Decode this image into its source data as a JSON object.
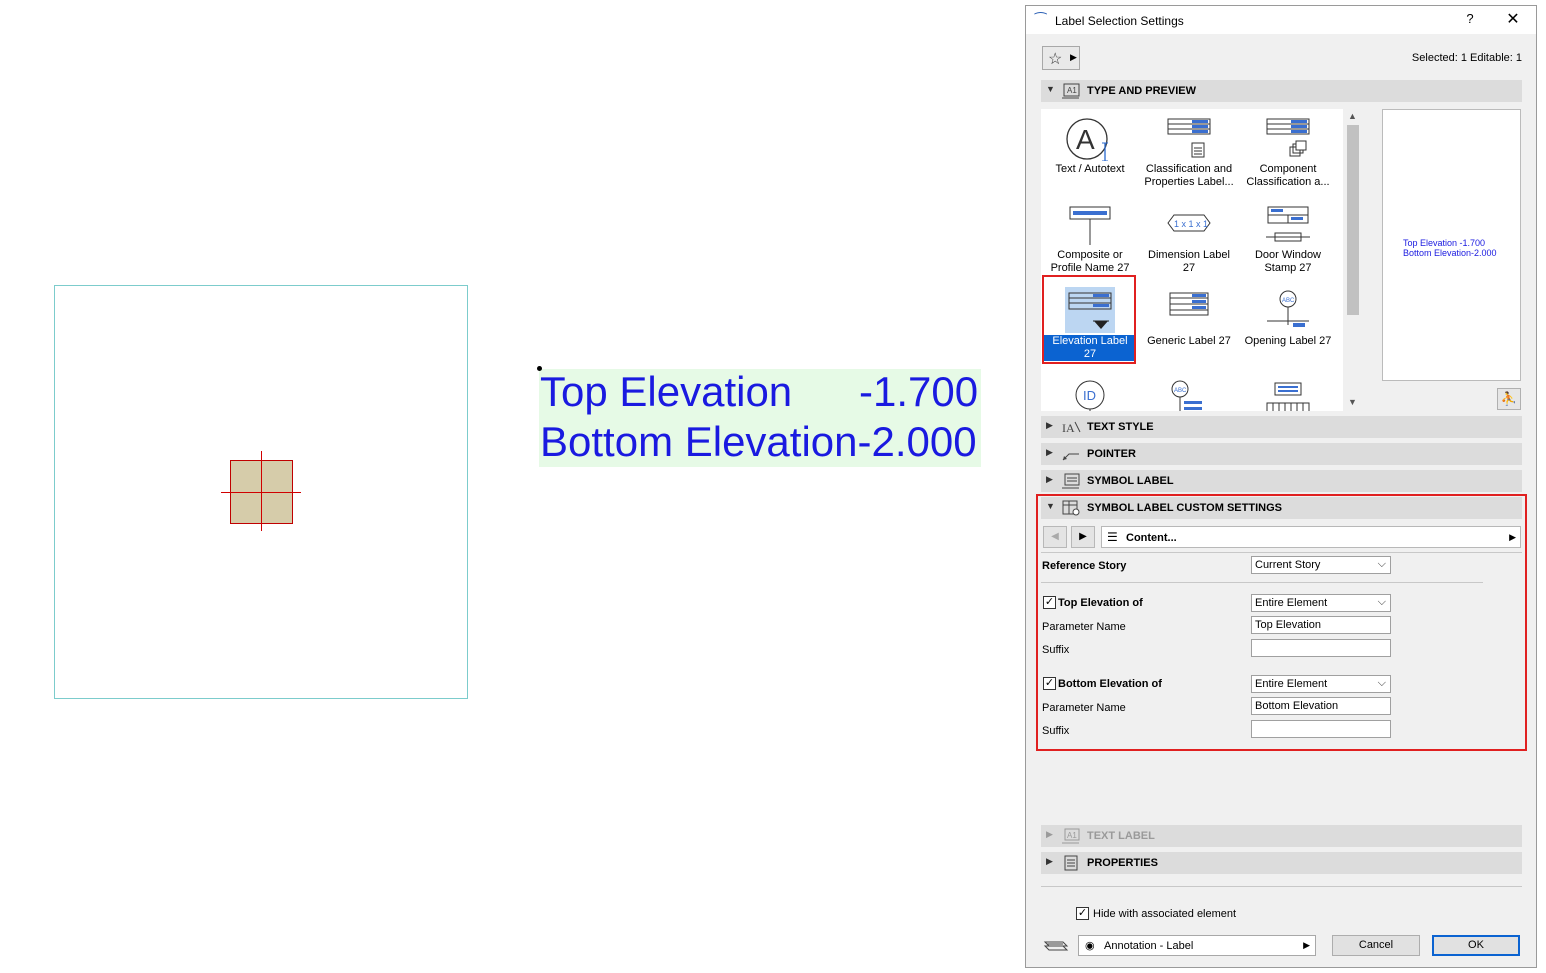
{
  "canvas": {
    "label_line1": "Top Elevation",
    "label_value1": "-1.700",
    "label_line2": "Bottom Elevation-2.000"
  },
  "dialog": {
    "title": "Label Selection Settings",
    "help": "?",
    "close": "✕",
    "selected_info": "Selected: 1 Editable: 1",
    "sections": {
      "type_preview": "TYPE AND PREVIEW",
      "text_style": "TEXT STYLE",
      "pointer": "POINTER",
      "symbol_label": "SYMBOL LABEL",
      "custom": "SYMBOL LABEL CUSTOM SETTINGS",
      "text_label": "TEXT LABEL",
      "properties": "PROPERTIES"
    },
    "types": [
      {
        "label1": "Text / Autotext",
        "label2": ""
      },
      {
        "label1": "Classification and",
        "label2": "Properties Label..."
      },
      {
        "label1": "Component",
        "label2": "Classification a..."
      },
      {
        "label1": "Composite or",
        "label2": "Profile Name 27"
      },
      {
        "label1": "Dimension Label",
        "label2": "27"
      },
      {
        "label1": "Door Window",
        "label2": "Stamp 27"
      },
      {
        "label1": "Elevation Label",
        "label2": "27"
      },
      {
        "label1": "Generic Label 27",
        "label2": ""
      },
      {
        "label1": "Opening Label 27",
        "label2": ""
      }
    ],
    "preview": {
      "line1": "Top Elevation     -1.700",
      "line2": "Bottom Elevation-2.000"
    },
    "custom": {
      "content": "Content...",
      "reference_story_label": "Reference Story",
      "reference_story_value": "Current Story",
      "top_elev_label": "Top Elevation of",
      "top_elev_value": "Entire Element",
      "param_name_label": "Parameter Name",
      "top_param_value": "Top Elevation",
      "suffix_label": "Suffix",
      "bottom_elev_label": "Bottom Elevation of",
      "bottom_elev_value": "Entire Element",
      "bottom_param_value": "Bottom Elevation"
    },
    "footer": {
      "hide_label": "Hide with associated element",
      "layer": "Annotation - Label",
      "cancel": "Cancel",
      "ok": "OK"
    }
  }
}
